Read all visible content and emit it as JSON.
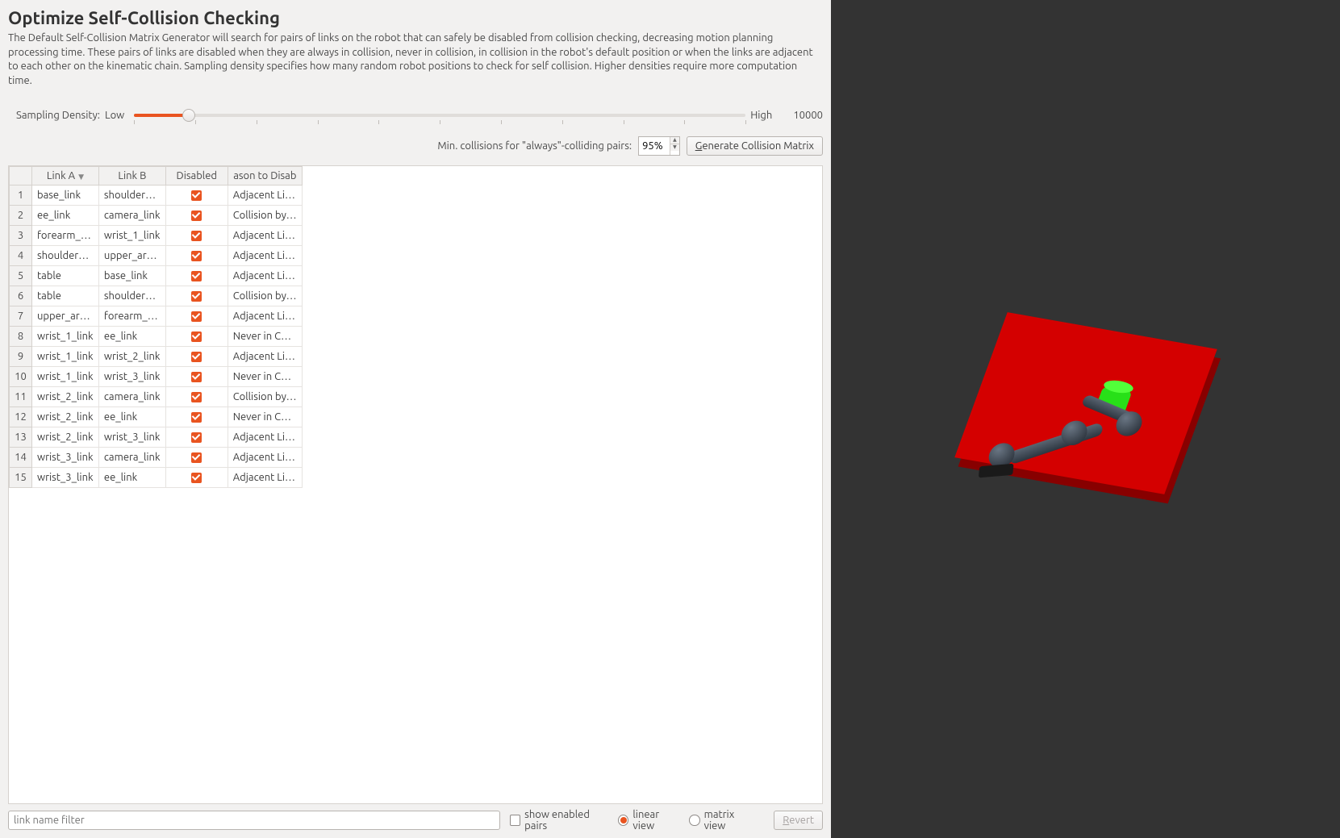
{
  "title": "Optimize Self-Collision Checking",
  "description": "The Default Self-Collision Matrix Generator will search for pairs of links on the robot that can safely be disabled from collision checking, decreasing motion planning processing time. These pairs of links are disabled when they are always in collision, never in collision, in collision in the robot's default position or when the links are adjacent to each other on the kinematic chain. Sampling density specifies how many random robot positions to check for self collision. Higher densities require more computation time.",
  "sampling": {
    "label_prefix": "Sampling Density:",
    "low": "Low",
    "high": "High",
    "value": "10000"
  },
  "min_collisions": {
    "label": "Min. collisions for \"always\"-colliding pairs:",
    "value": "95%"
  },
  "generate_button": "Generate Collision Matrix",
  "table": {
    "headers": {
      "link_a": "Link A",
      "link_b": "Link B",
      "disabled": "Disabled",
      "reason": "ason to Disab"
    },
    "rows": [
      {
        "n": "1",
        "a": "base_link",
        "b": "shoulder_link",
        "d": true,
        "r": "Adjacent Li…"
      },
      {
        "n": "2",
        "a": "ee_link",
        "b": "camera_link",
        "d": true,
        "r": "Collision by…"
      },
      {
        "n": "3",
        "a": "forearm_link",
        "b": "wrist_1_link",
        "d": true,
        "r": "Adjacent Li…"
      },
      {
        "n": "4",
        "a": "shoulder_link",
        "b": "upper_arm…",
        "d": true,
        "r": "Adjacent Li…"
      },
      {
        "n": "5",
        "a": "table",
        "b": "base_link",
        "d": true,
        "r": "Adjacent Li…"
      },
      {
        "n": "6",
        "a": "table",
        "b": "shoulder_link",
        "d": true,
        "r": "Collision by…"
      },
      {
        "n": "7",
        "a": "upper_arm…",
        "b": "forearm_link",
        "d": true,
        "r": "Adjacent Li…"
      },
      {
        "n": "8",
        "a": "wrist_1_link",
        "b": "ee_link",
        "d": true,
        "r": "Never in Co…"
      },
      {
        "n": "9",
        "a": "wrist_1_link",
        "b": "wrist_2_link",
        "d": true,
        "r": "Adjacent Li…"
      },
      {
        "n": "10",
        "a": "wrist_1_link",
        "b": "wrist_3_link",
        "d": true,
        "r": "Never in Co…"
      },
      {
        "n": "11",
        "a": "wrist_2_link",
        "b": "camera_link",
        "d": true,
        "r": "Collision by…"
      },
      {
        "n": "12",
        "a": "wrist_2_link",
        "b": "ee_link",
        "d": true,
        "r": "Never in Co…"
      },
      {
        "n": "13",
        "a": "wrist_2_link",
        "b": "wrist_3_link",
        "d": true,
        "r": "Adjacent Li…"
      },
      {
        "n": "14",
        "a": "wrist_3_link",
        "b": "camera_link",
        "d": true,
        "r": "Adjacent Li…"
      },
      {
        "n": "15",
        "a": "wrist_3_link",
        "b": "ee_link",
        "d": true,
        "r": "Adjacent Li…"
      }
    ]
  },
  "footer": {
    "filter_placeholder": "link name filter",
    "show_enabled": "show enabled pairs",
    "linear_view": "linear view",
    "matrix_view": "matrix view",
    "revert": "Revert"
  }
}
